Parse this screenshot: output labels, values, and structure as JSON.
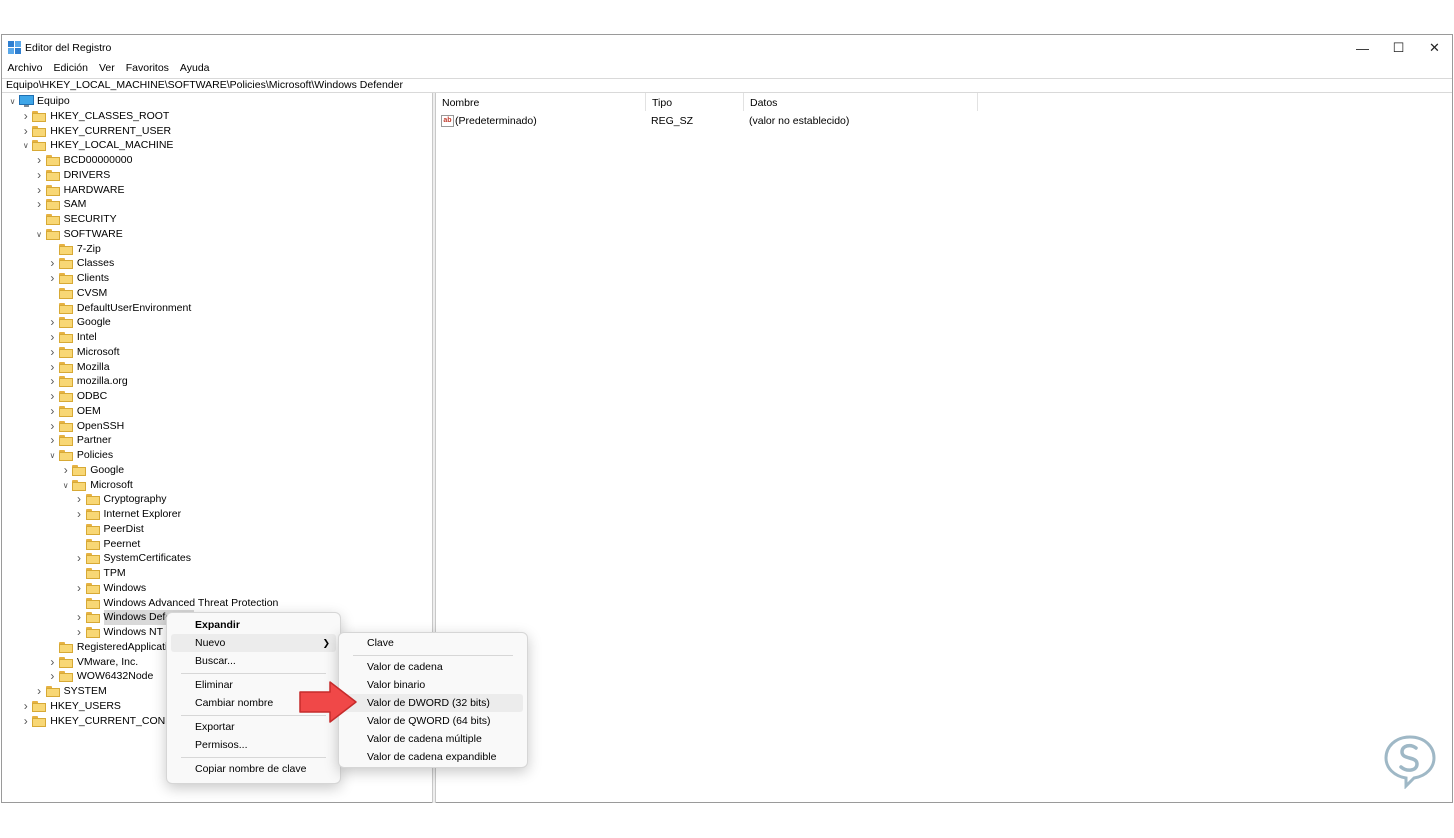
{
  "window": {
    "title": "Editor del Registro"
  },
  "window_controls": {
    "minimize": "—",
    "maximize": "☐",
    "close": "✕"
  },
  "menu": [
    "Archivo",
    "Edición",
    "Ver",
    "Favoritos",
    "Ayuda"
  ],
  "address": "Equipo\\HKEY_LOCAL_MACHINE\\SOFTWARE\\Policies\\Microsoft\\Windows Defender",
  "tree": [
    {
      "label": "Equipo",
      "depth": 0,
      "expander": "expanded",
      "icon": "computer-icon"
    },
    {
      "label": "HKEY_CLASSES_ROOT",
      "depth": 1,
      "expander": "collapsed"
    },
    {
      "label": "HKEY_CURRENT_USER",
      "depth": 1,
      "expander": "collapsed"
    },
    {
      "label": "HKEY_LOCAL_MACHINE",
      "depth": 1,
      "expander": "expanded"
    },
    {
      "label": "BCD00000000",
      "depth": 2,
      "expander": "collapsed"
    },
    {
      "label": "DRIVERS",
      "depth": 2,
      "expander": "collapsed"
    },
    {
      "label": "HARDWARE",
      "depth": 2,
      "expander": "collapsed"
    },
    {
      "label": "SAM",
      "depth": 2,
      "expander": "collapsed"
    },
    {
      "label": "SECURITY",
      "depth": 2,
      "expander": "none"
    },
    {
      "label": "SOFTWARE",
      "depth": 2,
      "expander": "expanded"
    },
    {
      "label": "7-Zip",
      "depth": 3,
      "expander": "none"
    },
    {
      "label": "Classes",
      "depth": 3,
      "expander": "collapsed"
    },
    {
      "label": "Clients",
      "depth": 3,
      "expander": "collapsed"
    },
    {
      "label": "CVSM",
      "depth": 3,
      "expander": "none"
    },
    {
      "label": "DefaultUserEnvironment",
      "depth": 3,
      "expander": "none"
    },
    {
      "label": "Google",
      "depth": 3,
      "expander": "collapsed"
    },
    {
      "label": "Intel",
      "depth": 3,
      "expander": "collapsed"
    },
    {
      "label": "Microsoft",
      "depth": 3,
      "expander": "collapsed"
    },
    {
      "label": "Mozilla",
      "depth": 3,
      "expander": "collapsed"
    },
    {
      "label": "mozilla.org",
      "depth": 3,
      "expander": "collapsed"
    },
    {
      "label": "ODBC",
      "depth": 3,
      "expander": "collapsed"
    },
    {
      "label": "OEM",
      "depth": 3,
      "expander": "collapsed"
    },
    {
      "label": "OpenSSH",
      "depth": 3,
      "expander": "collapsed"
    },
    {
      "label": "Partner",
      "depth": 3,
      "expander": "collapsed"
    },
    {
      "label": "Policies",
      "depth": 3,
      "expander": "expanded"
    },
    {
      "label": "Google",
      "depth": 4,
      "expander": "collapsed"
    },
    {
      "label": "Microsoft",
      "depth": 4,
      "expander": "expanded"
    },
    {
      "label": "Cryptography",
      "depth": 5,
      "expander": "collapsed"
    },
    {
      "label": "Internet Explorer",
      "depth": 5,
      "expander": "collapsed"
    },
    {
      "label": "PeerDist",
      "depth": 5,
      "expander": "none"
    },
    {
      "label": "Peernet",
      "depth": 5,
      "expander": "none"
    },
    {
      "label": "SystemCertificates",
      "depth": 5,
      "expander": "collapsed"
    },
    {
      "label": "TPM",
      "depth": 5,
      "expander": "none"
    },
    {
      "label": "Windows",
      "depth": 5,
      "expander": "collapsed"
    },
    {
      "label": "Windows Advanced Threat Protection",
      "depth": 5,
      "expander": "none"
    },
    {
      "label": "Windows Defender",
      "depth": 5,
      "expander": "collapsed",
      "selected": true
    },
    {
      "label": "Windows NT",
      "depth": 5,
      "expander": "collapsed"
    },
    {
      "label": "RegisteredApplications",
      "depth": 3,
      "expander": "none"
    },
    {
      "label": "VMware, Inc.",
      "depth": 3,
      "expander": "collapsed"
    },
    {
      "label": "WOW6432Node",
      "depth": 3,
      "expander": "collapsed"
    },
    {
      "label": "SYSTEM",
      "depth": 2,
      "expander": "collapsed"
    },
    {
      "label": "HKEY_USERS",
      "depth": 1,
      "expander": "collapsed"
    },
    {
      "label": "HKEY_CURRENT_CONFIG",
      "depth": 1,
      "expander": "collapsed"
    }
  ],
  "values_pane": {
    "columns": {
      "name": "Nombre",
      "type": "Tipo",
      "data": "Datos"
    },
    "rows": [
      {
        "name": "(Predeterminado)",
        "type": "REG_SZ",
        "data": "(valor no establecido)",
        "icon": "string-value-icon",
        "icon_text": "ab"
      }
    ]
  },
  "context_menu": {
    "expand": "Expandir",
    "new": "Nuevo",
    "find": "Buscar...",
    "delete": "Eliminar",
    "rename": "Cambiar nombre",
    "export": "Exportar",
    "permissions": "Permisos...",
    "copy_key_name": "Copiar nombre de clave"
  },
  "submenu": {
    "key": "Clave",
    "string": "Valor de cadena",
    "binary": "Valor binario",
    "dword": "Valor de DWORD (32 bits)",
    "qword": "Valor de QWORD (64 bits)",
    "multi_string": "Valor de cadena múltiple",
    "expandable_string": "Valor de cadena expandible"
  },
  "colors": {
    "accent_arrow": "#f04848",
    "folder": "#f8d775",
    "watermark": "#9fb8c6"
  }
}
